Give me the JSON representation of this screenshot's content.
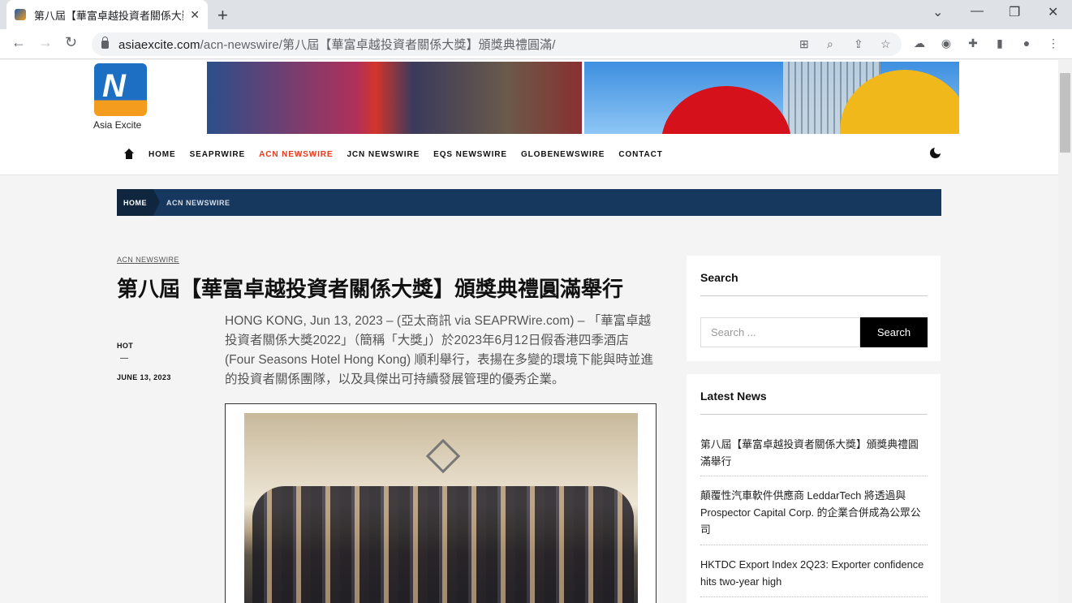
{
  "browser": {
    "tab_title": "第八屆【華富卓越投資者關係大獎】頒",
    "close": "✕",
    "new_tab": "+",
    "url_host": "asiaexcite.com",
    "url_path": "/acn-newswire/第八屆【華富卓越投資者關係大獎】頒獎典禮圓滿/"
  },
  "site": {
    "logo_text": "Asia Excite",
    "logo_mark": "N",
    "nav": [
      "HOME",
      "SEAPRWIRE",
      "ACN NEWSWIRE",
      "JCN NEWSWIRE",
      "EQS NEWSWIRE",
      "GLOBENEWSWIRE",
      "CONTACT"
    ],
    "active_nav": "ACN NEWSWIRE"
  },
  "breadcrumb": {
    "home": "HOME",
    "current": "ACN NEWSWIRE"
  },
  "article": {
    "category": "ACN NEWSWIRE",
    "title": "第八屆【華富卓越投資者關係大獎】頒獎典禮圓滿舉行",
    "tag": "HOT",
    "dash": "—",
    "date": "JUNE 13, 2023",
    "body": "HONG KONG, Jun 13, 2023 – (亞太商訊 via SEAPRWire.com) – 「華富卓越投資者關係大獎2022」（簡稱「大獎」）於2023年6月12日假香港四季酒店 (Four Seasons Hotel Hong Kong) 順利舉行，表揚在多變的環境下能與時並進的投資者關係團隊，以及具傑出可持續發展管理的優秀企業。"
  },
  "sidebar": {
    "search_title": "Search",
    "search_placeholder": "Search ...",
    "search_button": "Search",
    "news_title": "Latest News",
    "news": [
      "第八屆【華富卓越投資者關係大獎】頒獎典禮圓滿舉行",
      "顛覆性汽車軟件供應商 LeddarTech 將透過與 Prospector Capital Corp. 的企業合併成為公眾公司",
      "HKTDC Export Index 2Q23: Exporter confidence hits two-year high"
    ]
  }
}
